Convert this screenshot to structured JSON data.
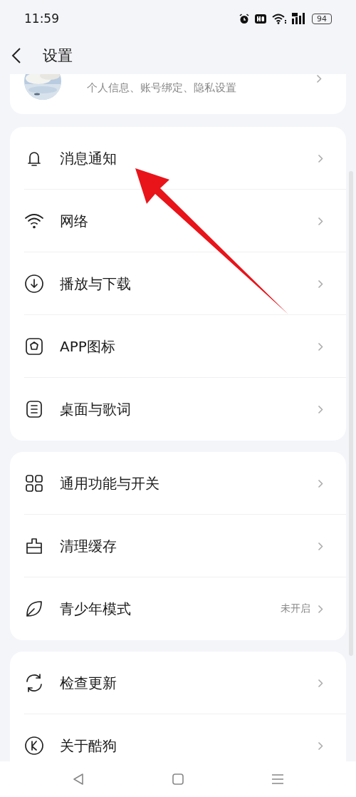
{
  "status_bar": {
    "time": "11:59",
    "battery": "94"
  },
  "header": {
    "title": "设置"
  },
  "profile": {
    "subtitle": "个人信息、账号绑定、隐私设置"
  },
  "groups": [
    {
      "items": [
        {
          "label": "消息通知"
        },
        {
          "label": "网络"
        },
        {
          "label": "播放与下载"
        },
        {
          "label": "APP图标"
        },
        {
          "label": "桌面与歌词"
        }
      ]
    },
    {
      "items": [
        {
          "label": "通用功能与开关"
        },
        {
          "label": "清理缓存"
        },
        {
          "label": "青少年模式",
          "value": "未开启"
        }
      ]
    },
    {
      "items": [
        {
          "label": "检查更新"
        },
        {
          "label": "关于酷狗"
        }
      ]
    }
  ]
}
